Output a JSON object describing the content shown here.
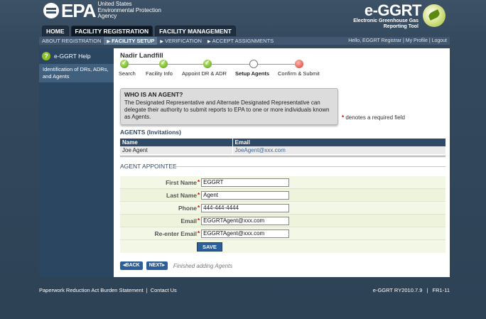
{
  "header": {
    "epa_logo": "EPA",
    "epa_agency_lines": [
      "United States",
      "Environmental Protection",
      "Agency"
    ],
    "app_title": "e-GGRT",
    "app_subtitle_lines": [
      "Electronic Greenhouse Gas",
      "Reporting Tool"
    ],
    "tabs": [
      {
        "label": "HOME",
        "active": false
      },
      {
        "label": "FACILITY REGISTRATION",
        "active": true
      },
      {
        "label": "FACILITY MANAGEMENT",
        "active": false
      }
    ]
  },
  "navbar": {
    "items": [
      {
        "label": "ABOUT REGISTRATION",
        "active": false
      },
      {
        "label": "FACILITY SETUP",
        "active": true
      },
      {
        "label": "VERIFICATION",
        "active": false
      },
      {
        "label": "ACCEPT ASSIGNMENTS",
        "active": false
      }
    ],
    "greeting": "Hello, EGGRT Registrar",
    "profile_link": "My Profile",
    "logout_link": "Logout"
  },
  "sidebar": {
    "help_label": "e-GGRT Help",
    "help_icon": "?",
    "link_label": "Identification of DRs, ADRs, and Agents"
  },
  "main": {
    "site_name": "Nadir Landfill",
    "steps": [
      {
        "label": "Search",
        "status": "done"
      },
      {
        "label": "Facility Info",
        "status": "done"
      },
      {
        "label": "Appoint DR & ADR",
        "status": "done"
      },
      {
        "label": "Setup Agents",
        "status": "current"
      },
      {
        "label": "Confirm & Submit",
        "status": "pending"
      }
    ],
    "who_title": "WHO IS AN AGENT?",
    "who_text": "The Designated Representative and Alternate Designated Representative can delegate their authority to submit reports to EPA to one or more individuals known as Agents.",
    "required_star": "*",
    "required_note": "denotes a required field",
    "agents_title": "AGENTS (Invitations)",
    "agents_table": {
      "headers": [
        "Name",
        "Email"
      ],
      "rows": [
        [
          "Joe Agent",
          "JoeAgent@xxx.com"
        ]
      ]
    },
    "appointee_legend": "AGENT APPOINTEE",
    "form": {
      "first_name_label": "First Name",
      "first_name_value": "EGGRT",
      "last_name_label": "Last Name",
      "last_name_value": "Agent",
      "phone_label": "Phone",
      "phone_value": "444-444-4444",
      "email_label": "Email",
      "email_value": "EGGRTAgent@xxx.com",
      "reemail_label": "Re-enter Email",
      "reemail_value": "EGGRTAgent@xxx.com",
      "save_label": "SAVE"
    },
    "back_label": "◂BACK",
    "next_label": "NEXT▸",
    "finished_text": "Finished adding Agents"
  },
  "footer": {
    "paperwork_link": "Paperwork Reduction Act Burden Statement",
    "contact_link": "Contact Us",
    "version": "e-GGRT RY2010.7.9",
    "build": "FR1-11"
  },
  "colors": {
    "header_bg": "#3d5266",
    "sidebar_bg": "#2a4660",
    "table_header": "#2f4a66",
    "button_blue": "#2c5f9a",
    "required_red": "#cc0000",
    "step_done_green": "#4f9a0f",
    "step_last_red": "#d43a2a"
  }
}
